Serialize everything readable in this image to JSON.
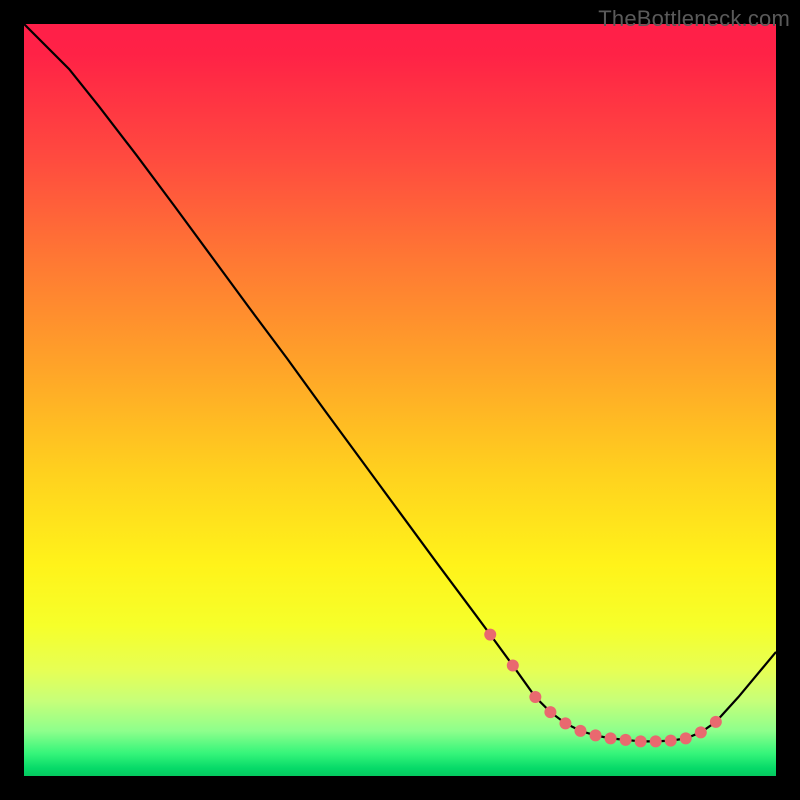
{
  "watermark": "TheBottleneck.com",
  "colors": {
    "curve": "#000000",
    "marker": "#e9696f",
    "frame_bg": "#000000"
  },
  "chart_data": {
    "type": "line",
    "title": "",
    "xlabel": "",
    "ylabel": "",
    "xlim": [
      0,
      100
    ],
    "ylim": [
      0,
      100
    ],
    "x": [
      0,
      6,
      10,
      15,
      20,
      25,
      30,
      35,
      40,
      45,
      50,
      55,
      60,
      62,
      65,
      68,
      70,
      72,
      74,
      76,
      78,
      80,
      82,
      84,
      86,
      88,
      90,
      92,
      95,
      100
    ],
    "values": [
      100,
      94,
      89,
      82.5,
      75.8,
      69,
      62.2,
      55.5,
      48.6,
      41.8,
      35,
      28.2,
      21.5,
      18.8,
      14.7,
      10.5,
      8.5,
      7.0,
      6.0,
      5.4,
      5.0,
      4.8,
      4.6,
      4.6,
      4.7,
      5.0,
      5.8,
      7.2,
      10.5,
      16.5
    ],
    "markers_x": [
      62,
      65,
      68,
      70,
      72,
      74,
      76,
      78,
      80,
      82,
      84,
      86,
      88,
      90,
      92
    ],
    "markers_y": [
      18.8,
      14.7,
      10.5,
      8.5,
      7.0,
      6.0,
      5.4,
      5.0,
      4.8,
      4.6,
      4.6,
      4.7,
      5.0,
      5.8,
      7.2
    ],
    "notes": "Axes are unlabeled in the source image; x and y are normalized to 0–100. The line descends steeply from the top-left, flattens to a minimum around x≈82–84, then rises toward the right edge. Pink markers highlight the valley region."
  }
}
